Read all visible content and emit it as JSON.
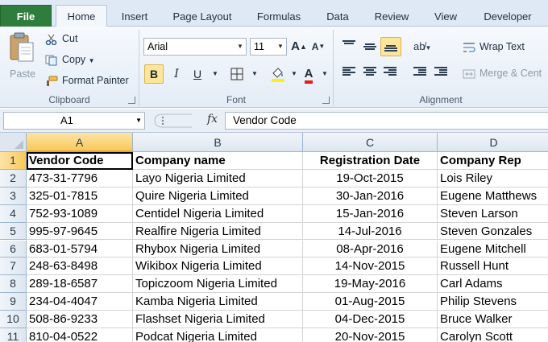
{
  "tabs": [
    "File",
    "Home",
    "Insert",
    "Page Layout",
    "Formulas",
    "Data",
    "Review",
    "View",
    "Developer"
  ],
  "ribbon": {
    "clipboard": {
      "paste": "Paste",
      "cut": "Cut",
      "copy": "Copy",
      "format_painter": "Format Painter",
      "label": "Clipboard"
    },
    "font": {
      "family": "Arial",
      "size": "11",
      "bold": "B",
      "italic": "I",
      "underline": "U",
      "label": "Font"
    },
    "alignment": {
      "wrap_text": "Wrap Text",
      "merge": "Merge & Cent",
      "label": "Alignment"
    }
  },
  "formula_bar": {
    "name_box": "A1",
    "fx": "fx",
    "content": "Vendor Code"
  },
  "sheet": {
    "columns": [
      "A",
      "B",
      "C",
      "D"
    ],
    "row_numbers": [
      "1",
      "2",
      "3",
      "4",
      "5",
      "6",
      "7",
      "8",
      "9",
      "10",
      "11"
    ],
    "rows": [
      [
        "Vendor Code",
        "Company name",
        "Registration Date",
        "Company Rep"
      ],
      [
        "473-31-7796",
        "Layo Nigeria Limited",
        "19-Oct-2015",
        "Lois Riley"
      ],
      [
        "325-01-7815",
        "Quire Nigeria Limited",
        "30-Jan-2016",
        "Eugene Matthews"
      ],
      [
        "752-93-1089",
        "Centidel Nigeria Limited",
        "15-Jan-2016",
        "Steven Larson"
      ],
      [
        "995-97-9645",
        "Realfire Nigeria Limited",
        "14-Jul-2016",
        "Steven Gonzales"
      ],
      [
        "683-01-5794",
        "Rhybox Nigeria Limited",
        "08-Apr-2016",
        "Eugene Mitchell"
      ],
      [
        "248-63-8498",
        "Wikibox Nigeria Limited",
        "14-Nov-2015",
        "Russell Hunt"
      ],
      [
        "289-18-6587",
        "Topiczoom Nigeria Limited",
        "19-May-2016",
        "Carl Adams"
      ],
      [
        "234-04-4047",
        "Kamba Nigeria Limited",
        "01-Aug-2015",
        "Philip Stevens"
      ],
      [
        "508-86-9233",
        "Flashset Nigeria Limited",
        "04-Dec-2015",
        "Bruce Walker"
      ],
      [
        "810-04-0522",
        "Podcat Nigeria Limited",
        "20-Nov-2015",
        "Carolyn Scott"
      ]
    ]
  },
  "colors": {
    "file_tab": "#2f7d3c",
    "selected_header": "#f8c95a",
    "active_toggle": "#fde59b",
    "font_color": "#e81c1c",
    "highlight": "#fff200"
  }
}
